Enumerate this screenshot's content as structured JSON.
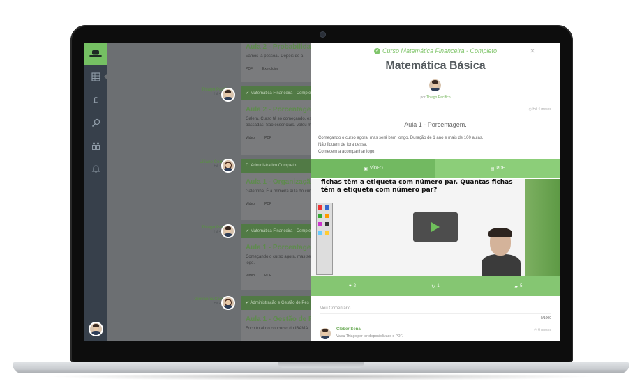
{
  "sidebar": {
    "items": [
      "courses-icon",
      "finance-icon",
      "search-icon",
      "classroom-icon",
      "notifications-icon"
    ]
  },
  "feed": {
    "top_post": {
      "title": "Aula 2 - Probabilida",
      "text": "Vamos lá pessoal. Depois de a",
      "pdf": "PDF",
      "exercises": "Exercícios"
    },
    "posts": [
      {
        "author": "Thiago Pacífico",
        "time": "Há 4 meses",
        "course": "Matemática Financeira - Completo",
        "title": "Aula 2 - Porcentagem",
        "text": "Galera, Curso tá só começando, es passadas. São essenciais. Valeu m",
        "video": "Vídeo",
        "pdf": "PDF"
      },
      {
        "author": "Liliane Coutinho",
        "time": "Há 4 meses",
        "course": "D. Administrativo Completo",
        "title": "Aula 1 - Organização A",
        "text": "Galerinha, É a primeira aula do curs",
        "video": "Vídeo",
        "pdf": "PDF"
      },
      {
        "author": "Thiago Pacífico",
        "time": "Há 4 meses",
        "course": "Matemática Financeira - Completo",
        "title": "Aula 1 - Porcentagem.",
        "text": "Começando o curso agora, mas se logo.",
        "video": "Vídeo",
        "pdf": "PDF"
      },
      {
        "author": "Giovanna Carranza",
        "time": "Há 4 meses",
        "course": "Administração e Gestão de Pes",
        "title": "Aula 1 - Gestão de Pes",
        "text": "Foco total no concurso do IBAMA",
        "video": "Vídeo",
        "pdf": ""
      }
    ]
  },
  "modal": {
    "course": "Curso Matemática Financeira - Completo",
    "title": "Matemática Básica",
    "by_prefix": "por",
    "author": "Thiago Pacífico",
    "time": "Há 4 meses",
    "lesson": "Aula 1 - Porcentagem.",
    "description": [
      "Começando o curso agora, mas será bem longo. Duração de 1 ano e mais de 100 aulas.",
      "Não fiquem de fora dessa.",
      "Comecem a acompanhar logo."
    ],
    "tabs": {
      "video": "VÍDEO",
      "pdf": "PDF"
    },
    "video_board_text": "fichas têm a etiqueta com número par. Quantas fichas têm a etiqueta com número par?",
    "stats": {
      "likes": "2",
      "shares": "1",
      "comments": "5"
    },
    "comment_placeholder": "Meu Comentário",
    "char_count": "0/1000",
    "comment": {
      "author": "Cleber Sena",
      "text": "Valeu Thiago por ter disponibilizado o PDF.",
      "time": "6 meses"
    }
  },
  "colors": {
    "brand_green": "#75c063",
    "sidebar": "#37404b",
    "tab_active": "#72b961"
  }
}
